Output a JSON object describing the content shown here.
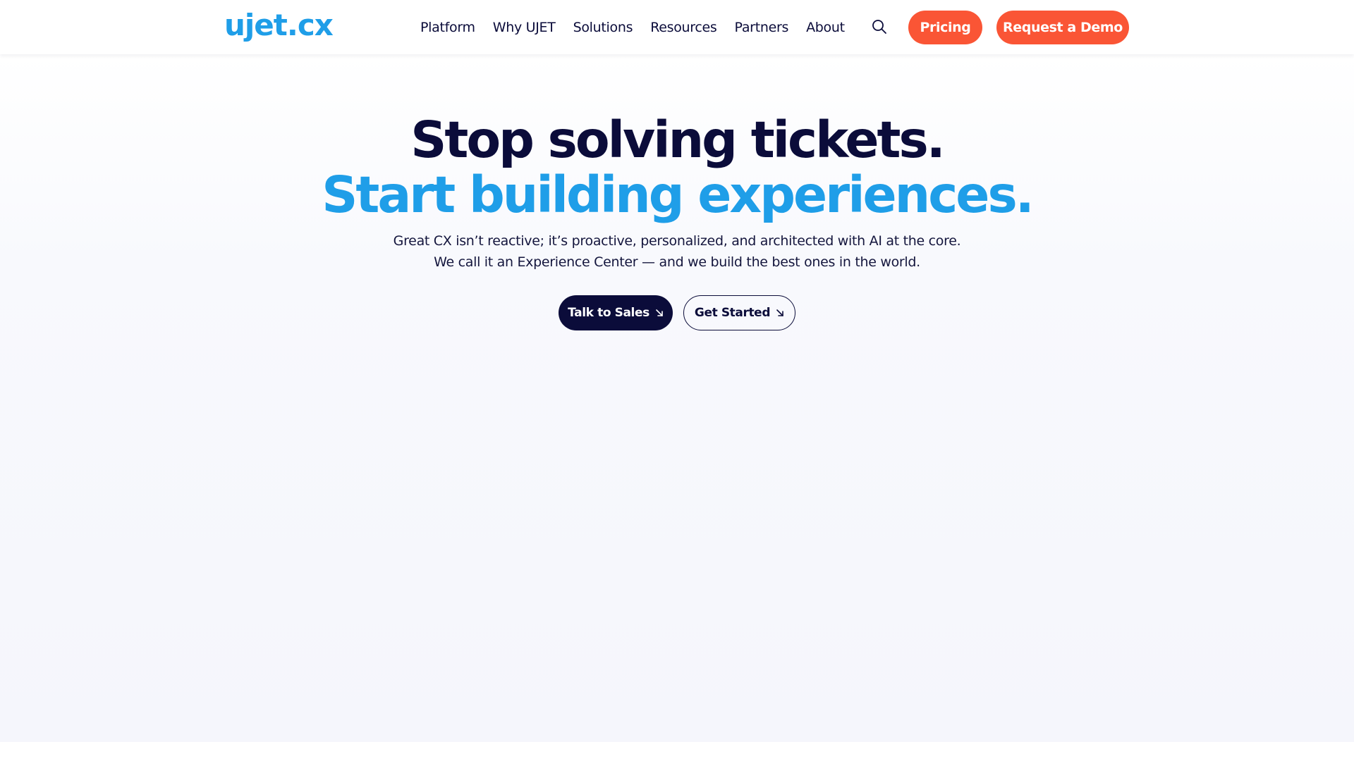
{
  "header": {
    "logo": "ujet.cx",
    "nav": [
      {
        "label": "Platform"
      },
      {
        "label": "Why UJET"
      },
      {
        "label": "Solutions"
      },
      {
        "label": "Resources"
      },
      {
        "label": "Partners"
      },
      {
        "label": "About"
      }
    ],
    "pricing_label": "Pricing",
    "demo_label": "Request a Demo",
    "search_icon": "search-icon"
  },
  "hero": {
    "title_line1": "Stop solving tickets.",
    "title_line2": "Start building experiences.",
    "subtitle_line1": "Great CX isn’t reactive; it’s proactive, personalized, and architected with AI at the core.",
    "subtitle_line2": "We call it an Experience Center — and we build the best ones in the world.",
    "primary_cta": "Talk to Sales",
    "secondary_cta": "Get Started",
    "cta_icon": "arrow-down-right-icon"
  },
  "colors": {
    "navy": "#0b0c3a",
    "brand_blue": "#1f9ee8",
    "accent_orange": "#fa5535",
    "hero_background": "#f5f6fc"
  }
}
